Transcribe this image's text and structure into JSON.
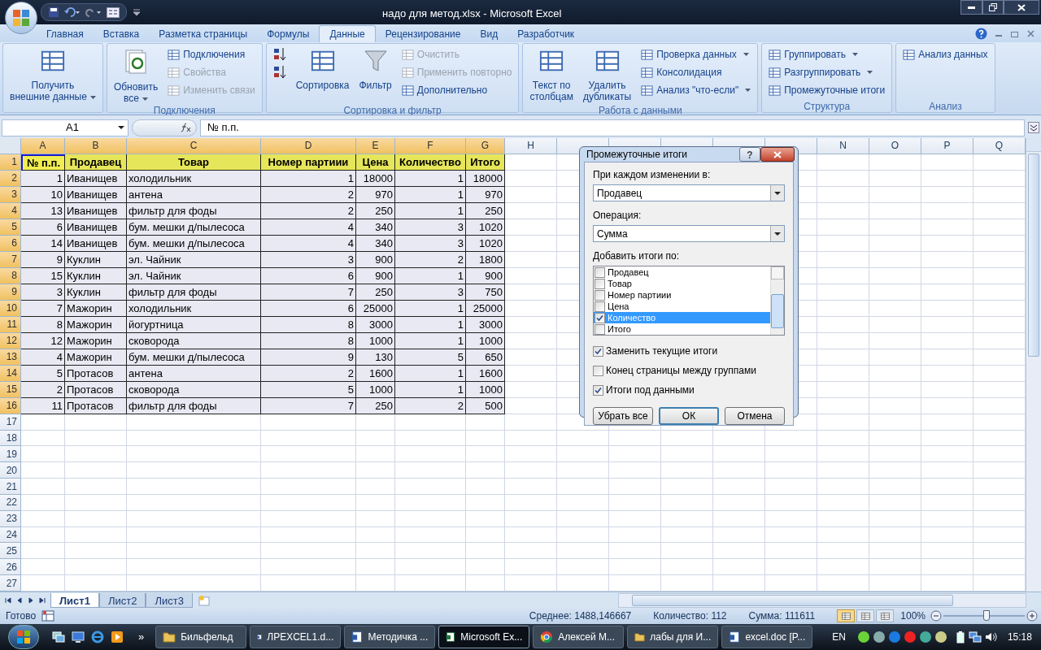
{
  "window": {
    "title": "надо для метод.xlsx - Microsoft Excel"
  },
  "tabs": [
    {
      "label": "Главная",
      "selected": false
    },
    {
      "label": "Вставка",
      "selected": false
    },
    {
      "label": "Разметка страницы",
      "selected": false
    },
    {
      "label": "Формулы",
      "selected": false
    },
    {
      "label": "Данные",
      "selected": true
    },
    {
      "label": "Рецензирование",
      "selected": false
    },
    {
      "label": "Вид",
      "selected": false
    },
    {
      "label": "Разработчик",
      "selected": false
    }
  ],
  "ribbon_groups": [
    {
      "items": [
        {
          "kind": "large",
          "lines": [
            "Получить",
            "внешние данные"
          ],
          "disabled": false,
          "dropdown": true
        }
      ]
    },
    {
      "label": "Подключения",
      "items": [
        {
          "kind": "large",
          "lines": [
            "Обновить",
            "все"
          ],
          "disabled": false,
          "dropdown": true
        },
        {
          "kind": "small",
          "label": "Подключения",
          "disabled": false,
          "dropdown": false
        },
        {
          "kind": "small",
          "label": "Свойства",
          "disabled": true,
          "dropdown": false
        },
        {
          "kind": "small",
          "label": "Изменить связи",
          "disabled": true,
          "dropdown": false
        }
      ]
    },
    {
      "label": "Сортировка и фильтр",
      "items": [
        {
          "kind": "icon",
          "disabled": false
        },
        {
          "kind": "icon",
          "disabled": false
        },
        {
          "kind": "large",
          "lines": [
            "Сортировка"
          ],
          "disabled": false,
          "dropdown": false
        },
        {
          "kind": "large",
          "lines": [
            "Фильтр"
          ],
          "disabled": false,
          "dropdown": false
        },
        {
          "kind": "small",
          "label": "Очистить",
          "disabled": true,
          "dropdown": false
        },
        {
          "kind": "small",
          "label": "Применить повторно",
          "disabled": true,
          "dropdown": false
        },
        {
          "kind": "small",
          "label": "Дополнительно",
          "disabled": false,
          "dropdown": false
        }
      ]
    },
    {
      "label": "Работа с данными",
      "items": [
        {
          "kind": "large",
          "lines": [
            "Текст по",
            "столбцам"
          ],
          "disabled": false,
          "dropdown": false
        },
        {
          "kind": "large",
          "lines": [
            "Удалить",
            "дубликаты"
          ],
          "disabled": false,
          "dropdown": false
        },
        {
          "kind": "small",
          "label": "Проверка данных",
          "disabled": false,
          "dropdown": true
        },
        {
          "kind": "small",
          "label": "Консолидация",
          "disabled": false,
          "dropdown": false
        },
        {
          "kind": "small",
          "label": "Анализ \"что-если\"",
          "disabled": false,
          "dropdown": true
        }
      ]
    },
    {
      "label": "Структура",
      "items": [
        {
          "kind": "small",
          "label": "Группировать",
          "disabled": false,
          "dropdown": true
        },
        {
          "kind": "small",
          "label": "Разгруппировать",
          "disabled": false,
          "dropdown": true
        },
        {
          "kind": "small",
          "label": "Промежуточные итоги",
          "disabled": false,
          "dropdown": false
        }
      ]
    },
    {
      "label": "Анализ",
      "items": [
        {
          "kind": "small",
          "label": "Анализ данных",
          "disabled": false,
          "dropdown": false
        }
      ]
    }
  ],
  "formula_bar": {
    "name_box": "A1",
    "formula": "№ п.п."
  },
  "columns": [
    {
      "letter": "A",
      "selected": true
    },
    {
      "letter": "B",
      "selected": true
    },
    {
      "letter": "C",
      "selected": true
    },
    {
      "letter": "D",
      "selected": true
    },
    {
      "letter": "E",
      "selected": true
    },
    {
      "letter": "F",
      "selected": true
    },
    {
      "letter": "G",
      "selected": true
    },
    {
      "letter": "H",
      "selected": false
    },
    {
      "selected": false
    },
    {
      "selected": false
    },
    {
      "selected": false
    },
    {
      "selected": false
    },
    {
      "selected": false
    },
    {
      "letter": "N",
      "selected": false
    },
    {
      "letter": "O",
      "selected": false
    },
    {
      "letter": "P",
      "selected": false
    },
    {
      "letter": "Q",
      "selected": false
    }
  ],
  "rows": [
    {
      "number": "1",
      "selected": true,
      "kind": "header",
      "cells": [
        "№ п.п.",
        "Продавец",
        "Товар",
        "Номер партиии",
        "Цена",
        "Количество",
        "Итого"
      ]
    },
    {
      "number": "2",
      "selected": true,
      "kind": "data",
      "cells": [
        "1",
        "Иванищев",
        "холодильник",
        "1",
        "18000",
        "1",
        "18000"
      ]
    },
    {
      "number": "3",
      "selected": true,
      "kind": "data",
      "cells": [
        "10",
        "Иванищев",
        "антена",
        "2",
        "970",
        "1",
        "970"
      ]
    },
    {
      "number": "4",
      "selected": true,
      "kind": "data",
      "cells": [
        "13",
        "Иванищев",
        "фильтр для фоды",
        "2",
        "250",
        "1",
        "250"
      ]
    },
    {
      "number": "5",
      "selected": true,
      "kind": "data",
      "cells": [
        "6",
        "Иванищев",
        "бум. мешки д/пылесоса",
        "4",
        "340",
        "3",
        "1020"
      ]
    },
    {
      "number": "6",
      "selected": true,
      "kind": "data",
      "cells": [
        "14",
        "Иванищев",
        "бум. мешки д/пылесоса",
        "4",
        "340",
        "3",
        "1020"
      ]
    },
    {
      "number": "7",
      "selected": true,
      "kind": "data",
      "cells": [
        "9",
        "Куклин",
        "эл. Чайник",
        "3",
        "900",
        "2",
        "1800"
      ]
    },
    {
      "number": "8",
      "selected": true,
      "kind": "data",
      "cells": [
        "15",
        "Куклин",
        "эл. Чайник",
        "6",
        "900",
        "1",
        "900"
      ]
    },
    {
      "number": "9",
      "selected": true,
      "kind": "data",
      "cells": [
        "3",
        "Куклин",
        "фильтр для фоды",
        "7",
        "250",
        "3",
        "750"
      ]
    },
    {
      "number": "10",
      "selected": true,
      "kind": "data",
      "cells": [
        "7",
        "Мажорин",
        "холодильник",
        "6",
        "25000",
        "1",
        "25000"
      ]
    },
    {
      "number": "11",
      "selected": true,
      "kind": "data",
      "cells": [
        "8",
        "Мажорин",
        "йогуртница",
        "8",
        "3000",
        "1",
        "3000"
      ]
    },
    {
      "number": "12",
      "selected": true,
      "kind": "data",
      "cells": [
        "12",
        "Мажорин",
        "сковорода",
        "8",
        "1000",
        "1",
        "1000"
      ]
    },
    {
      "number": "13",
      "selected": true,
      "kind": "data",
      "cells": [
        "4",
        "Мажорин",
        "бум. мешки д/пылесоса",
        "9",
        "130",
        "5",
        "650"
      ]
    },
    {
      "number": "14",
      "selected": true,
      "kind": "data",
      "cells": [
        "5",
        "Протасов",
        "антена",
        "2",
        "1600",
        "1",
        "1600"
      ]
    },
    {
      "number": "15",
      "selected": true,
      "kind": "data",
      "cells": [
        "2",
        "Протасов",
        "сковорода",
        "5",
        "1000",
        "1",
        "1000"
      ]
    },
    {
      "number": "16",
      "selected": true,
      "kind": "data",
      "cells": [
        "11",
        "Протасов",
        "фильтр для фоды",
        "7",
        "250",
        "2",
        "500"
      ]
    },
    {
      "number": "17",
      "selected": false,
      "kind": "empty"
    },
    {
      "number": "18",
      "selected": false,
      "kind": "empty"
    },
    {
      "number": "19",
      "selected": false,
      "kind": "empty"
    },
    {
      "number": "20",
      "selected": false,
      "kind": "empty"
    },
    {
      "number": "21",
      "selected": false,
      "kind": "empty"
    },
    {
      "number": "22",
      "selected": false,
      "kind": "empty"
    },
    {
      "number": "23",
      "selected": false,
      "kind": "empty"
    },
    {
      "number": "24",
      "selected": false,
      "kind": "empty"
    },
    {
      "number": "25",
      "selected": false,
      "kind": "empty"
    },
    {
      "number": "26",
      "selected": false,
      "kind": "empty"
    },
    {
      "number": "27",
      "selected": false,
      "kind": "empty"
    }
  ],
  "dialog": {
    "title": "Промежуточные итоги",
    "help": "?",
    "group_by_label": "При каждом изменении в:",
    "group_by_value": "Продавец",
    "operation_label": "Операция:",
    "operation_value": "Сумма",
    "list_label": "Добавить итоги по:",
    "list": [
      {
        "label": "Продавец",
        "checked": false,
        "selected": false
      },
      {
        "label": "Товар",
        "checked": false,
        "selected": false
      },
      {
        "label": "Номер партиии",
        "checked": false,
        "selected": false
      },
      {
        "label": "Цена",
        "checked": false,
        "selected": false
      },
      {
        "label": "Количество",
        "checked": true,
        "selected": true
      },
      {
        "label": "Итого",
        "checked": false,
        "selected": false
      }
    ],
    "options": [
      {
        "label": "Заменить текущие итоги",
        "checked": true
      },
      {
        "label": "Конец страницы между группами",
        "checked": false
      },
      {
        "label": "Итоги под данными",
        "checked": true
      }
    ],
    "buttons": [
      {
        "label": "Убрать все",
        "default": false
      },
      {
        "label": "ОК",
        "default": true
      },
      {
        "label": "Отмена",
        "default": false
      }
    ]
  },
  "sheet_tabs": [
    {
      "label": "Лист1",
      "selected": true
    },
    {
      "label": "Лист2",
      "selected": false
    },
    {
      "label": "Лист3",
      "selected": false
    }
  ],
  "status_bar": {
    "ready": "Готово",
    "stats": [
      "Среднее: 1488,146667",
      "Количество: 112",
      "Сумма: 111611"
    ],
    "views": [
      {
        "selected": true
      },
      {
        "selected": false
      },
      {
        "selected": false
      }
    ],
    "zoom": "100%",
    "zoom_slider": {
      "level": 0.53
    }
  },
  "taskbar": {
    "more": "»",
    "buttons": [
      {
        "label": "Бильфельд",
        "kind": "folder",
        "selected": false
      },
      {
        "label": "ЛРEXCEL1.d...",
        "kind": "word",
        "selected": false
      },
      {
        "label": "Методичка ...",
        "kind": "word",
        "selected": false
      },
      {
        "label": "Microsoft Ex...",
        "kind": "excel",
        "selected": true
      },
      {
        "label": "Алексей М...",
        "kind": "browser",
        "selected": false
      },
      {
        "label": "лабы для И...",
        "kind": "folder",
        "selected": false
      },
      {
        "label": "excel.doc [P...",
        "kind": "word",
        "selected": false
      }
    ],
    "language": "EN",
    "time": "15:18"
  }
}
